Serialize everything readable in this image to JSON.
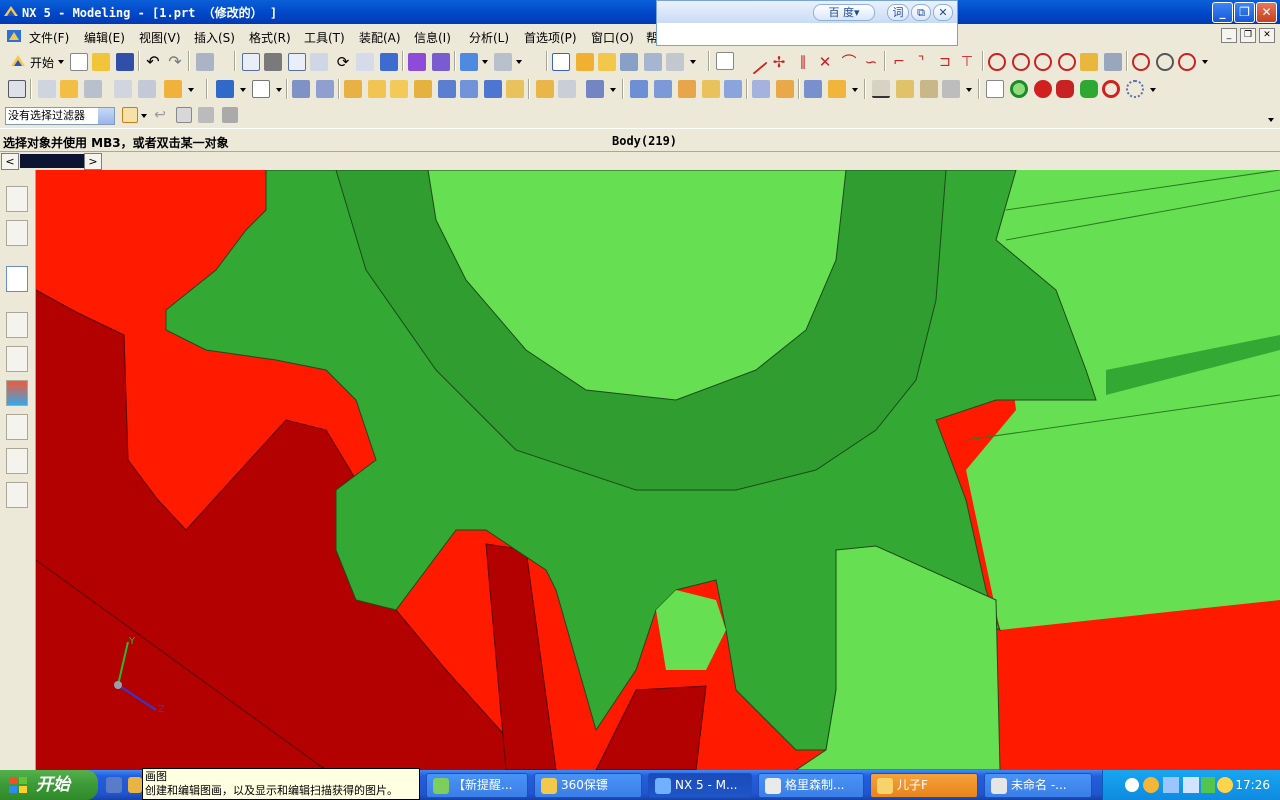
{
  "window": {
    "title": "NX 5 - Modeling - [1.prt （修改的） ]",
    "controls": {
      "minimize": "_",
      "maximize": "❐",
      "close": "✕"
    }
  },
  "baidu_bar": {
    "search_label": "百 度▾",
    "word_label": "词",
    "copy_label": "⧉",
    "close_label": "✕"
  },
  "menu": {
    "items": [
      "文件(F)",
      "编辑(E)",
      "视图(V)",
      "插入(S)",
      "格式(R)",
      "工具(T)",
      "装配(A)",
      "信息(I)",
      "分析(L)",
      "首选项(P)",
      "窗口(O)",
      "帮"
    ],
    "mdi": {
      "minimize": "_",
      "restore": "❐",
      "close": "✕"
    }
  },
  "toolbar1": {
    "start_label": "开始"
  },
  "selection": {
    "filter_value": "没有选择过滤器"
  },
  "status": {
    "prompt": "选择对象并使用 MB3，或者双击某一对象",
    "info": "Body(219)"
  },
  "tabstrip": {
    "prev": "<",
    "next": ">"
  },
  "triad": {
    "y": "Y",
    "z": "Z"
  },
  "tooltip": {
    "title": "画图",
    "text": "创建和编辑图画，以及显示和编辑扫描获得的图片。"
  },
  "taskbar": {
    "start": "开始",
    "tasks": [
      {
        "label": "【新提醒...",
        "color": "#7ccf5a"
      },
      {
        "label": "360保镖",
        "color": "#f2c94c"
      },
      {
        "label": "NX 5 - M...",
        "color": "#6fb0ff"
      },
      {
        "label": "格里森制...",
        "color": "#eaeaea"
      },
      {
        "label": "儿子F",
        "color": "#f7d36b"
      },
      {
        "label": "未命名 -...",
        "color": "#e6e6e6"
      }
    ],
    "clock": "17:26"
  },
  "colors": {
    "viewport_red": "#ff1a00",
    "rack_dark": "#b30000",
    "gear_green": "#33a833",
    "gear_light": "#66e052"
  }
}
